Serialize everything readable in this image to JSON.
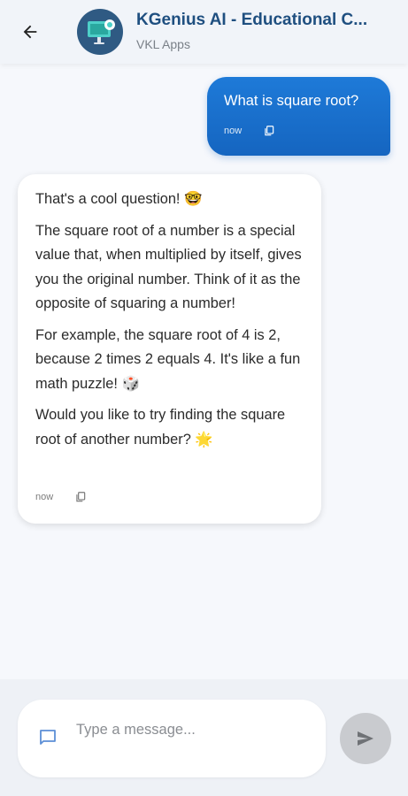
{
  "header": {
    "title": "KGenius AI - Educational C...",
    "subtitle": "VKL Apps",
    "back_icon": "arrow-back-icon",
    "avatar_icon": "robot-board-icon"
  },
  "messages": [
    {
      "role": "user",
      "text": "What is square root?",
      "time": "now"
    },
    {
      "role": "assistant",
      "paragraphs": [
        "That's a cool question! 🤓",
        "The square root of a number is a special value that, when multiplied by itself, gives you the original number. Think of it as the opposite of squaring a number!",
        "For example, the square root of 4 is 2, because 2 times 2 equals 4. It's like a fun math puzzle! 🎲",
        "Would you like to try finding the square root of another number? 🌟"
      ],
      "time": "now"
    }
  ],
  "composer": {
    "placeholder": "Type a message...",
    "value": "",
    "chat_icon": "chat-bubble-icon",
    "send_icon": "send-icon"
  },
  "colors": {
    "accent": "#1565c0",
    "title": "#1f4f80",
    "background": "#f6f8fc"
  }
}
